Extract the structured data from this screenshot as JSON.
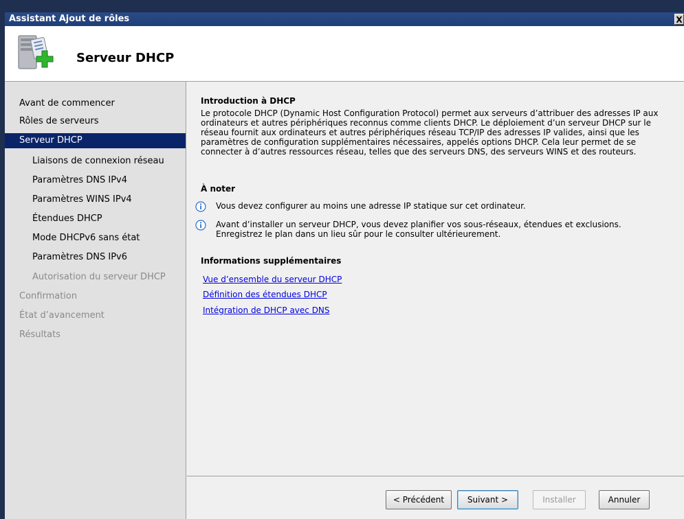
{
  "window": {
    "title": "Assistant Ajout de rôles",
    "close_glyph": "X"
  },
  "header": {
    "title": "Serveur DHCP",
    "icon": "server-with-green-plus-icon"
  },
  "nav": {
    "items": [
      {
        "label": "Avant de commencer",
        "state": "normal"
      },
      {
        "label": "Rôles de serveurs",
        "state": "normal"
      },
      {
        "label": "Serveur DHCP",
        "state": "selected"
      },
      {
        "label": "Liaisons de connexion réseau",
        "state": "normal"
      },
      {
        "label": "Paramètres DNS IPv4",
        "state": "normal"
      },
      {
        "label": "Paramètres WINS IPv4",
        "state": "normal"
      },
      {
        "label": "Étendues DHCP",
        "state": "normal"
      },
      {
        "label": "Mode DHCPv6 sans état",
        "state": "normal"
      },
      {
        "label": "Paramètres DNS IPv6",
        "state": "normal"
      },
      {
        "label": "Autorisation du serveur DHCP",
        "state": "disabled"
      },
      {
        "label": "Confirmation",
        "state": "disabled"
      },
      {
        "label": "État d’avancement",
        "state": "disabled"
      },
      {
        "label": "Résultats",
        "state": "disabled"
      }
    ]
  },
  "content": {
    "intro_heading": "Introduction à DHCP",
    "intro_text": "Le protocole DHCP (Dynamic Host Configuration Protocol) permet aux serveurs d’attribuer des adresses IP aux ordinateurs et autres périphériques reconnus comme clients DHCP. Le déploiement d’un serveur DHCP sur le réseau fournit aux ordinateurs et autres périphériques réseau TCP/IP des adresses IP valides, ainsi que les paramètres de configuration supplémentaires nécessaires, appelés options DHCP. Cela leur permet de se connecter à d’autres ressources réseau, telles que des serveurs DNS, des serveurs WINS et des routeurs.",
    "notes_heading": "À noter",
    "notes": [
      "Vous devez configurer au moins une adresse IP statique sur cet ordinateur.",
      "Avant d’installer un serveur DHCP, vous devez planifier vos sous-réseaux, étendues et exclusions. Enregistrez le plan dans un lieu sûr pour le consulter ultérieurement."
    ],
    "more_heading": "Informations supplémentaires",
    "links": [
      "Vue d’ensemble du serveur DHCP",
      "Définition des étendues DHCP",
      "Intégration de DHCP avec DNS"
    ]
  },
  "footer": {
    "previous": "< Précédent",
    "next": "Suivant >",
    "install": "Installer",
    "cancel": "Annuler"
  },
  "colors": {
    "title_bar": "#1f3f78",
    "selected_nav": "#0a246a",
    "link": "#0000e0",
    "info_icon": "#2a6fc9"
  }
}
